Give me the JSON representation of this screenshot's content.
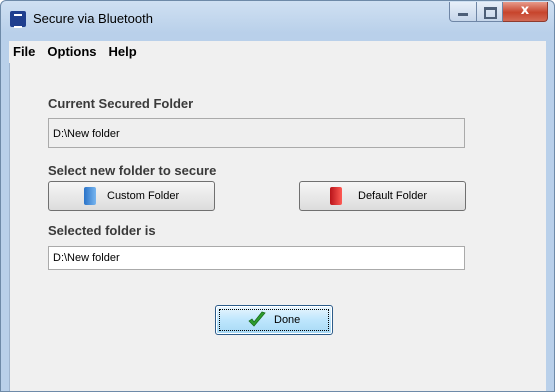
{
  "window": {
    "title": "Secure via Bluetooth",
    "close_glyph": "x"
  },
  "menu": [
    "File",
    "Options",
    "Help"
  ],
  "current": {
    "label": "Current Secured Folder",
    "value": "D:\\New folder"
  },
  "select": {
    "label": "Select new folder to secure",
    "custom_button": "Custom Folder",
    "default_button": "Default Folder"
  },
  "selected": {
    "label": "Selected folder is",
    "value": "D:\\New folder"
  },
  "done_button": "Done",
  "icons": {
    "custom": "blue-book-icon",
    "default": "red-book-icon",
    "done": "checkmark-icon"
  }
}
